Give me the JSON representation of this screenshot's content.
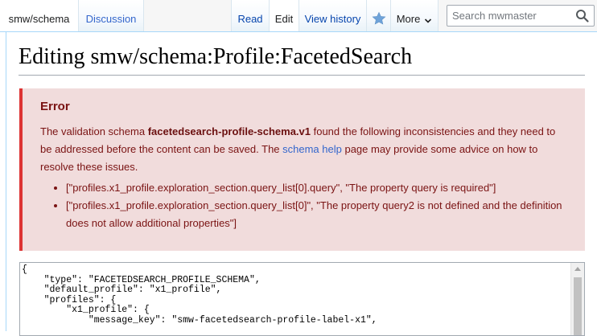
{
  "tabs": {
    "namespace": "smw/schema",
    "discussion": "Discussion",
    "read": "Read",
    "edit": "Edit",
    "history": "View history",
    "more": "More",
    "watch_icon": "star-icon",
    "more_icon": "chevron-down-icon"
  },
  "search": {
    "placeholder": "Search mwmaster",
    "icon": "search-icon"
  },
  "page": {
    "title": "Editing smw/schema:Profile:FacetedSearch"
  },
  "error": {
    "title": "Error",
    "intro_before": "The validation schema ",
    "schema_name": "facetedsearch-profile-schema.v1",
    "intro_middle": " found the following inconsistencies and they need to be addressed before the content can be saved. The ",
    "help_link": "schema help",
    "intro_after": " page may provide some advice on how to resolve these issues.",
    "items": [
      "[\"profiles.x1_profile.exploration_section.query_list[0].query\", \"The property query is required\"]",
      "[\"profiles.x1_profile.exploration_section.query_list[0]\", \"The property query2 is not defined and the definition does not allow additional properties\"]"
    ]
  },
  "editor": {
    "content": "{\n    \"type\": \"FACETEDSEARCH_PROFILE_SCHEMA\",\n    \"default_profile\": \"x1_profile\",\n    \"profiles\": {\n        \"x1_profile\": {\n            \"message_key\": \"smw-facetedsearch-profile-label-x1\","
  },
  "colors": {
    "error_accent": "#d33",
    "error_background": "#f1dcdc",
    "link": "#3366cc",
    "tab_border": "#a7d7f9"
  }
}
